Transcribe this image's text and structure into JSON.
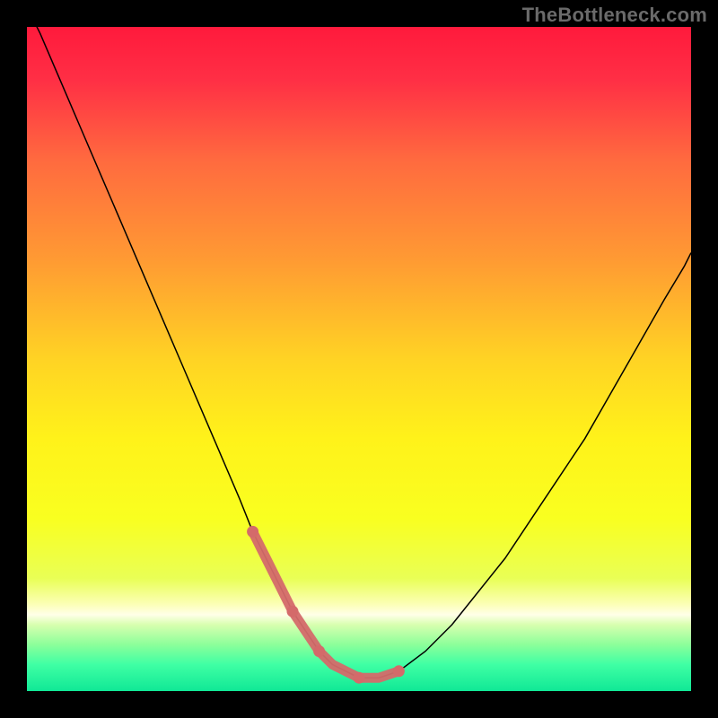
{
  "watermark": "TheBottleneck.com",
  "chart_data": {
    "type": "line",
    "title": "",
    "xlabel": "",
    "ylabel": "",
    "xlim": [
      0,
      100
    ],
    "ylim": [
      0,
      100
    ],
    "background": "rainbow-vertical-gradient",
    "gradient_stops": [
      {
        "pos": 0.0,
        "color": "#ff1a3c"
      },
      {
        "pos": 0.08,
        "color": "#ff2f45"
      },
      {
        "pos": 0.2,
        "color": "#ff6a3f"
      },
      {
        "pos": 0.35,
        "color": "#ff9a33"
      },
      {
        "pos": 0.5,
        "color": "#ffd324"
      },
      {
        "pos": 0.62,
        "color": "#fff21a"
      },
      {
        "pos": 0.74,
        "color": "#f9ff20"
      },
      {
        "pos": 0.83,
        "color": "#e9ff55"
      },
      {
        "pos": 0.87,
        "color": "#fcffb8"
      },
      {
        "pos": 0.885,
        "color": "#ffffe8"
      },
      {
        "pos": 0.9,
        "color": "#d8ffb0"
      },
      {
        "pos": 0.93,
        "color": "#8cff9a"
      },
      {
        "pos": 0.96,
        "color": "#3fffa4"
      },
      {
        "pos": 1.0,
        "color": "#10e896"
      }
    ],
    "series": [
      {
        "name": "bottleneck-curve",
        "color": "#000000",
        "width": 1.5,
        "x": [
          0,
          2,
          5,
          8,
          11,
          14,
          17,
          20,
          23,
          26,
          29,
          32,
          34,
          36,
          38,
          40,
          42,
          44,
          46,
          48,
          50,
          53,
          56,
          60,
          64,
          68,
          72,
          76,
          80,
          84,
          88,
          92,
          96,
          99,
          100
        ],
        "y": [
          103,
          99,
          92,
          85,
          78,
          71,
          64,
          57,
          50,
          43,
          36,
          29,
          24,
          20,
          16,
          12,
          9,
          6,
          4,
          3,
          2,
          2,
          3,
          6,
          10,
          15,
          20,
          26,
          32,
          38,
          45,
          52,
          59,
          64,
          66
        ]
      }
    ],
    "accent": {
      "name": "trough-highlight",
      "color": "#d46a6a",
      "width": 11,
      "linecap": "round",
      "x": [
        34,
        36,
        38,
        40,
        42,
        44,
        46,
        48,
        50,
        53,
        56
      ],
      "y": [
        24,
        20,
        16,
        12,
        9,
        6,
        4,
        3,
        2,
        2,
        3
      ],
      "dots_at": [
        34,
        40,
        44,
        50,
        56
      ]
    }
  }
}
